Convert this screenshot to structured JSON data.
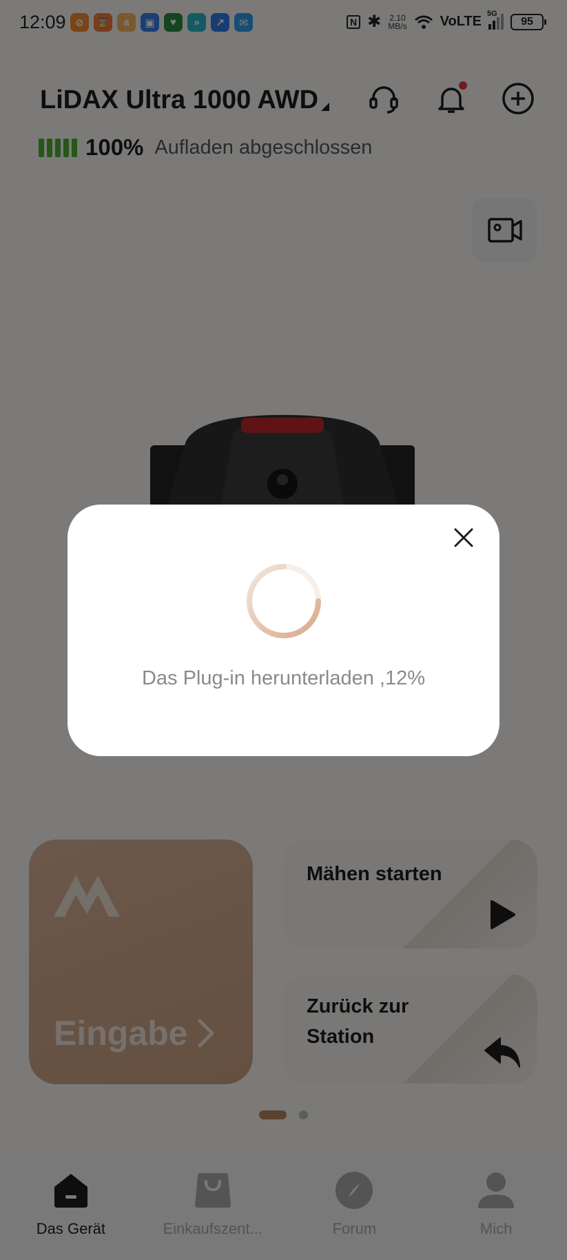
{
  "status_bar": {
    "time": "12:09",
    "speed_value": "2.10",
    "speed_unit": "MB/s",
    "network": "VoLTE",
    "generation": "5G",
    "battery": "95"
  },
  "header": {
    "device_name": "LiDAX Ultra 1000 AWD"
  },
  "battery": {
    "percent": "100%",
    "status": "Aufladen abgeschlossen",
    "level": 1.0,
    "color": "#4caf2f"
  },
  "cards": {
    "enter_label": "Eingabe",
    "start_mowing": "Mähen starten",
    "return_station_line1": "Zurück zur",
    "return_station_line2": "Station",
    "accent_color": "#c9a081"
  },
  "pager": {
    "current_page": 1,
    "total_pages": 2
  },
  "bottom_nav": {
    "items": [
      {
        "label": "Das Gerät",
        "icon": "home-icon",
        "active": true
      },
      {
        "label": "Einkaufszent...",
        "icon": "shopping-bag-icon",
        "active": false
      },
      {
        "label": "Forum",
        "icon": "compass-icon",
        "active": false
      },
      {
        "label": "Mich",
        "icon": "person-icon",
        "active": false
      }
    ]
  },
  "modal": {
    "message": "Das Plug-in herunterladen ,12%",
    "progress_percent": 12,
    "spinner_color": "#d9a98a"
  }
}
